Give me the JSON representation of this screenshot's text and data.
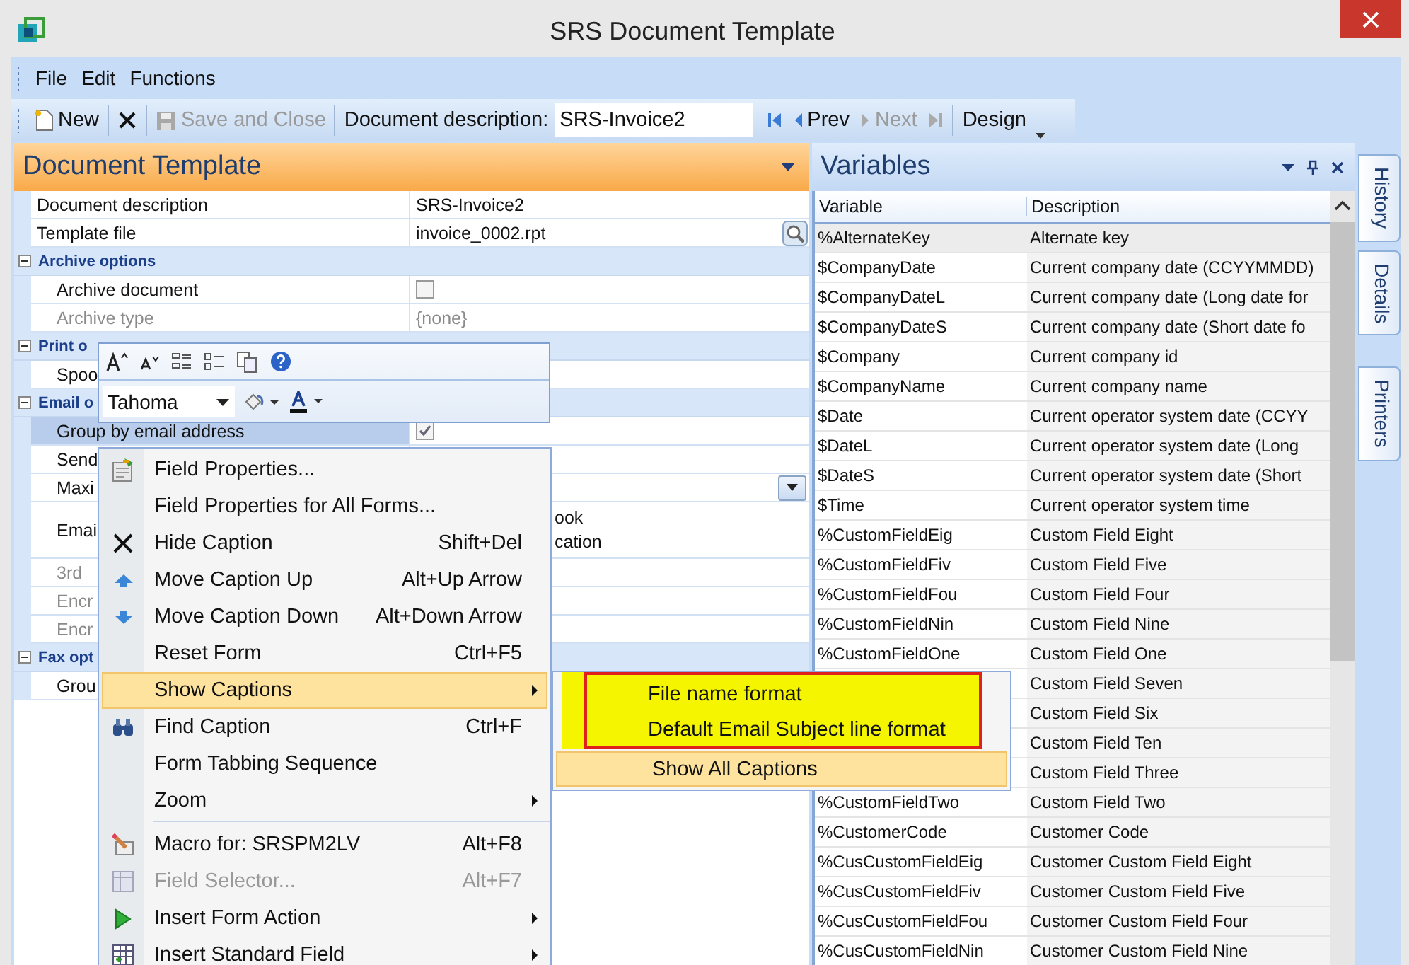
{
  "window": {
    "title": "SRS Document Template"
  },
  "menu_bar": [
    "File",
    "Edit",
    "Functions"
  ],
  "toolbar": [
    [
      {
        "kind": "new",
        "label": "New",
        "disabled": false
      }
    ],
    [
      {
        "kind": "delete"
      }
    ],
    [
      {
        "kind": "save",
        "label": "Save and Close",
        "disabled": true
      }
    ],
    [
      {
        "kind": "field",
        "label": "Document description:",
        "value": "SRS-Invoice2"
      },
      {
        "kind": "first",
        "disabled": false
      },
      {
        "kind": "prev",
        "label": "Prev",
        "disabled": false
      },
      {
        "kind": "next",
        "label": "Next",
        "disabled": true
      },
      {
        "kind": "last",
        "disabled": true
      }
    ],
    [
      {
        "kind": "design",
        "label": "Design"
      }
    ]
  ],
  "document_template": {
    "title": "Document Template",
    "rows": [
      {
        "kind": "text",
        "label": "Document description",
        "value": "SRS-Invoice2",
        "selected": false,
        "disabled": false
      },
      {
        "kind": "browse",
        "label": "Template file",
        "value": "invoice_0002.rpt",
        "selected": false,
        "disabled": false
      },
      {
        "kind": "group",
        "label": "Archive options",
        "expanded": true,
        "children": [
          {
            "kind": "checkbox",
            "label": "Archive document",
            "checked": false,
            "selected": false,
            "disabled": false
          },
          {
            "kind": "text",
            "label": "Archive type",
            "value": "{none}",
            "selected": false,
            "disabled": true
          }
        ]
      },
      {
        "kind": "group",
        "label": "Print o",
        "expanded": true,
        "children": [
          {
            "kind": "text",
            "label": "Spoo",
            "selected": false,
            "disabled": false
          }
        ]
      },
      {
        "kind": "group",
        "label": "Email o",
        "expanded": true,
        "children": [
          {
            "kind": "checkbox",
            "label": "Group by email address",
            "checked": true,
            "selected": true,
            "disabled": false
          },
          {
            "kind": "text",
            "label": "Send",
            "selected": false,
            "disabled": false
          },
          {
            "kind": "dropdown",
            "label": "Maxi",
            "selected": false,
            "disabled": false
          },
          {
            "kind": "multiline",
            "label": "Emai",
            "value_lines": [
              "ook",
              "cation"
            ],
            "selected": false,
            "disabled": false
          },
          {
            "kind": "text",
            "label": "3rd",
            "selected": false,
            "disabled": true
          },
          {
            "kind": "text",
            "label": "Encr",
            "selected": false,
            "disabled": true
          },
          {
            "kind": "text",
            "label": "Encr",
            "selected": false,
            "disabled": true
          }
        ]
      },
      {
        "kind": "group",
        "label": "Fax opt",
        "expanded": true,
        "children": [
          {
            "kind": "text",
            "label": "Grou",
            "selected": false,
            "disabled": false
          }
        ]
      }
    ]
  },
  "mini_toolbar": {
    "font": "Tahoma"
  },
  "context_menu": {
    "items": [
      {
        "kind": "item",
        "label": "Field Properties...",
        "has_submenu": false,
        "disabled": false,
        "selected": false
      },
      {
        "kind": "item",
        "label": "Field Properties for All Forms...",
        "has_submenu": false,
        "disabled": false,
        "selected": false
      },
      {
        "kind": "item",
        "label": "Hide Caption",
        "shortcut": "Shift+Del",
        "has_submenu": false,
        "disabled": false,
        "selected": false
      },
      {
        "kind": "item",
        "label": "Move Caption Up",
        "shortcut": "Alt+Up Arrow",
        "has_submenu": false,
        "disabled": false,
        "selected": false
      },
      {
        "kind": "item",
        "label": "Move Caption Down",
        "shortcut": "Alt+Down Arrow",
        "has_submenu": false,
        "disabled": false,
        "selected": false
      },
      {
        "kind": "item",
        "label": "Reset Form",
        "shortcut": "Ctrl+F5",
        "has_submenu": false,
        "disabled": false,
        "selected": false
      },
      {
        "kind": "item",
        "label": "Show Captions",
        "has_submenu": true,
        "disabled": false,
        "selected": true
      },
      {
        "kind": "item",
        "label": "Find Caption",
        "shortcut": "Ctrl+F",
        "has_submenu": false,
        "disabled": false,
        "selected": false
      },
      {
        "kind": "item",
        "label": "Form Tabbing Sequence",
        "has_submenu": false,
        "disabled": false,
        "selected": false
      },
      {
        "kind": "item",
        "label": "Zoom",
        "has_submenu": true,
        "disabled": false,
        "selected": false
      },
      {
        "kind": "separator"
      },
      {
        "kind": "item",
        "label": "Macro for: SRSPM2LV",
        "shortcut": "Alt+F8",
        "has_submenu": false,
        "disabled": false,
        "selected": false
      },
      {
        "kind": "item",
        "label": "Field Selector...",
        "shortcut": "Alt+F7",
        "has_submenu": false,
        "disabled": true,
        "selected": false
      },
      {
        "kind": "item",
        "label": "Insert Form Action",
        "has_submenu": true,
        "disabled": false,
        "selected": false
      },
      {
        "kind": "item",
        "label": "Insert Standard Field",
        "has_submenu": true,
        "disabled": false,
        "selected": false
      }
    ]
  },
  "submenu": {
    "items": [
      {
        "label": "File name format",
        "marked": true,
        "selected": false
      },
      {
        "label": "Default Email Subject line format",
        "marked": true,
        "selected": false
      },
      {
        "label": "Show All Captions",
        "marked": false,
        "selected": true
      }
    ]
  },
  "variables": {
    "title": "Variables",
    "columns": [
      "Variable",
      "Description"
    ],
    "rows": [
      {
        "variable": "%AlternateKey",
        "description": "Alternate key",
        "selected": true
      },
      {
        "variable": "$CompanyDate",
        "description": "Current company date (CCYYMMDD)",
        "selected": false
      },
      {
        "variable": "$CompanyDateL",
        "description": "Current company date (Long date for",
        "selected": false
      },
      {
        "variable": "$CompanyDateS",
        "description": "Current company date (Short date fo",
        "selected": false
      },
      {
        "variable": "$Company",
        "description": "Current company id",
        "selected": false
      },
      {
        "variable": "$CompanyName",
        "description": "Current company name",
        "selected": false
      },
      {
        "variable": "$Date",
        "description": "Current operator system date (CCYY",
        "selected": false
      },
      {
        "variable": "$DateL",
        "description": "Current operator system date (Long",
        "selected": false
      },
      {
        "variable": "$DateS",
        "description": "Current operator system date (Short",
        "selected": false
      },
      {
        "variable": "$Time",
        "description": "Current operator system time",
        "selected": false
      },
      {
        "variable": "%CustomFieldEig",
        "description": "Custom Field Eight",
        "selected": false
      },
      {
        "variable": "%CustomFieldFiv",
        "description": "Custom Field Five",
        "selected": false
      },
      {
        "variable": "%CustomFieldFou",
        "description": "Custom Field Four",
        "selected": false
      },
      {
        "variable": "%CustomFieldNin",
        "description": "Custom Field Nine",
        "selected": false
      },
      {
        "variable": "%CustomFieldOne",
        "description": "Custom Field One",
        "selected": false
      },
      {
        "description": "Custom Field Seven",
        "selected": false
      },
      {
        "description": "Custom Field Six",
        "selected": false
      },
      {
        "description": "Custom Field Ten",
        "selected": false
      },
      {
        "description": "Custom Field Three",
        "selected": false
      },
      {
        "variable": "%CustomFieldTwo",
        "description": "Custom Field Two",
        "selected": false
      },
      {
        "variable": "%CustomerCode",
        "description": "Customer Code",
        "selected": false
      },
      {
        "variable": "%CusCustomFieldEig",
        "description": "Customer Custom Field Eight",
        "selected": false
      },
      {
        "variable": "%CusCustomFieldFiv",
        "description": "Customer Custom Field Five",
        "selected": false
      },
      {
        "variable": "%CusCustomFieldFou",
        "description": "Customer Custom Field Four",
        "selected": false
      },
      {
        "variable": "%CusCustomFieldNin",
        "description": "Customer Custom Field Nine",
        "selected": false
      }
    ]
  },
  "side_tabs": [
    {
      "label": "History",
      "selected": false
    },
    {
      "label": "Details",
      "selected": false
    },
    {
      "label": "Printers",
      "selected": false
    }
  ]
}
